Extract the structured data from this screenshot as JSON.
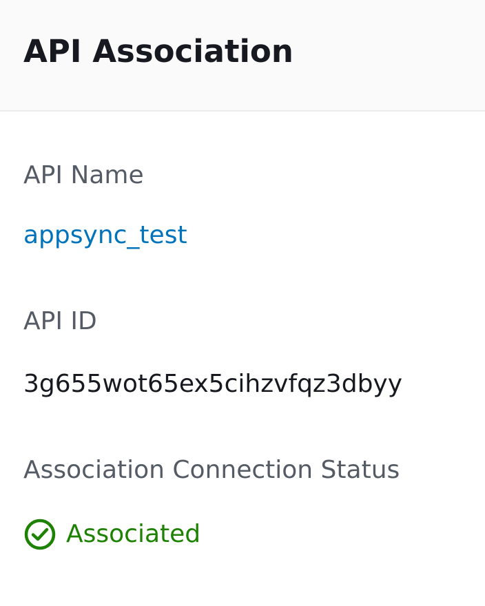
{
  "header": {
    "title": "API Association"
  },
  "fields": {
    "api_name": {
      "label": "API Name",
      "value": "appsync_test"
    },
    "api_id": {
      "label": "API ID",
      "value": "3g655wot65ex5cihzvfqz3dbyy"
    },
    "status": {
      "label": "Association Connection Status",
      "value": "Associated",
      "icon": "check-circle-icon"
    }
  },
  "colors": {
    "link": "#0073bb",
    "success": "#1d8102",
    "label": "#545b64",
    "text": "#16191f",
    "header_bg": "#fafafa"
  }
}
